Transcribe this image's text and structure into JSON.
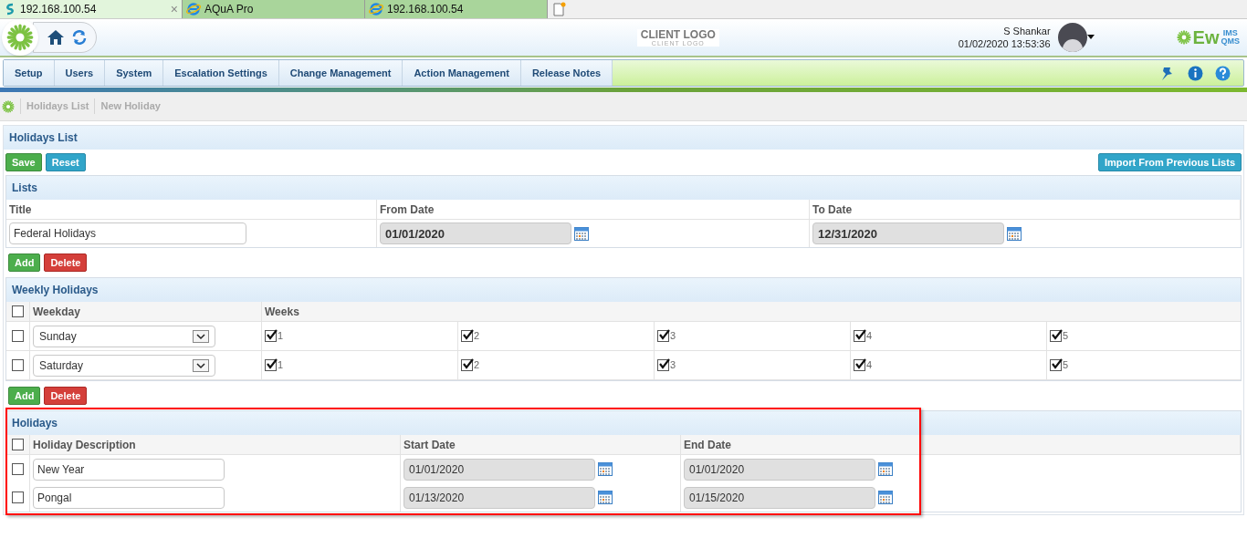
{
  "browser_tabs": [
    {
      "title": "192.168.100.54",
      "selected": true,
      "close": "×"
    },
    {
      "title": "AQuA Pro",
      "selected": false
    },
    {
      "title": "192.168.100.54",
      "selected": false
    }
  ],
  "header": {
    "client_logo": "CLIENT LOGO",
    "client_logo_sub": "CLIENT LOGO",
    "user_name": "S Shankar",
    "datetime": "01/02/2020 13:53:36",
    "brand": {
      "main": "Ew",
      "top": "IMS",
      "bottom": "QMS"
    }
  },
  "nav": [
    {
      "label": "Setup"
    },
    {
      "label": "Users"
    },
    {
      "label": "System"
    },
    {
      "label": "Escalation Settings"
    },
    {
      "label": "Change Management"
    },
    {
      "label": "Action Management"
    },
    {
      "label": "Release Notes"
    }
  ],
  "breadcrumb": [
    "Holidays List",
    "New Holiday"
  ],
  "page_title": "Holidays List",
  "toolbar": {
    "save": "Save",
    "reset": "Reset",
    "import": "Import From Previous Lists"
  },
  "lists": {
    "title": "Lists",
    "columns": [
      "Title",
      "From Date",
      "To Date"
    ],
    "title_value": "Federal Holidays",
    "from_date": "01/01/2020",
    "to_date": "12/31/2020"
  },
  "weekly_actions": {
    "add": "Add",
    "delete": "Delete"
  },
  "weekly": {
    "title": "Weekly Holidays",
    "header_checked": false,
    "columns": [
      "Weekday",
      "Weeks"
    ],
    "rows": [
      {
        "checked": false,
        "weekday": "Sunday",
        "weeks": [
          {
            "label": "1",
            "checked": true
          },
          {
            "label": "2",
            "checked": true
          },
          {
            "label": "3",
            "checked": true
          },
          {
            "label": "4",
            "checked": true
          },
          {
            "label": "5",
            "checked": true
          }
        ]
      },
      {
        "checked": false,
        "weekday": "Saturday",
        "weeks": [
          {
            "label": "1",
            "checked": true
          },
          {
            "label": "2",
            "checked": true
          },
          {
            "label": "3",
            "checked": true
          },
          {
            "label": "4",
            "checked": true
          },
          {
            "label": "5",
            "checked": true
          }
        ]
      }
    ]
  },
  "holiday_actions": {
    "add": "Add",
    "delete": "Delete"
  },
  "holidays": {
    "title": "Holidays",
    "highlighted": true,
    "header_checked": false,
    "columns": [
      "Holiday Description",
      "Start Date",
      "End Date"
    ],
    "rows": [
      {
        "checked": false,
        "description": "New Year",
        "start": "01/01/2020",
        "end": "01/01/2020"
      },
      {
        "checked": false,
        "description": "Pongal",
        "start": "01/13/2020",
        "end": "01/15/2020"
      }
    ]
  }
}
